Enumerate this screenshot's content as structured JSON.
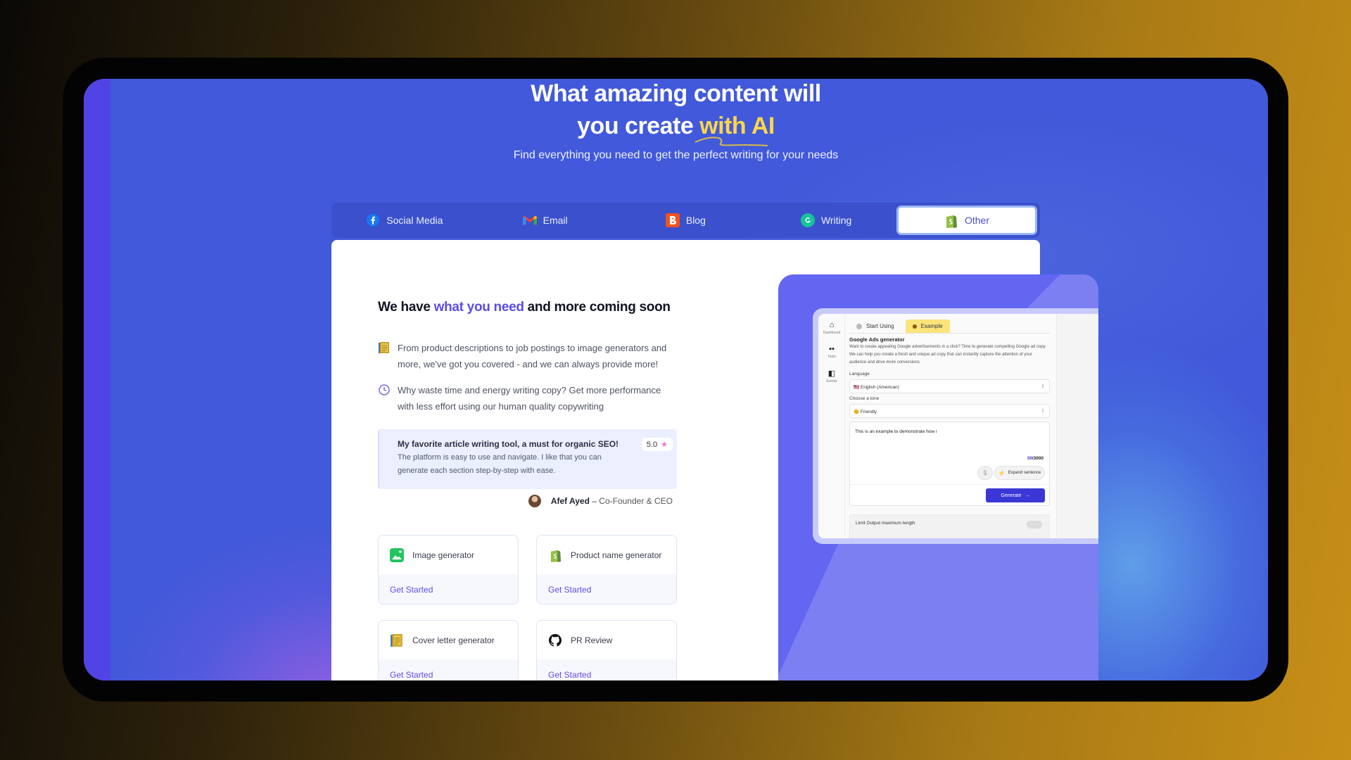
{
  "hero": {
    "title_line1": "What amazing content will",
    "title_line2_prefix": "you create ",
    "title_line2_highlight": "with AI",
    "subtitle": "Find everything you need to get the perfect writing for your needs"
  },
  "tabs": [
    {
      "label": "Social Media",
      "icon": "facebook-icon",
      "active": false
    },
    {
      "label": "Email",
      "icon": "gmail-icon",
      "active": false
    },
    {
      "label": "Blog",
      "icon": "blogger-icon",
      "active": false
    },
    {
      "label": "Writing",
      "icon": "grammarly-icon",
      "active": false
    },
    {
      "label": "Other",
      "icon": "shopify-icon",
      "active": true
    }
  ],
  "content": {
    "title_prefix": "We have ",
    "title_accent": "what you need",
    "title_suffix": " and more coming soon",
    "features": [
      {
        "icon": "notebook-icon",
        "text": "From product descriptions to job postings to image generators and more, we've got you covered - and we can always provide more!"
      },
      {
        "icon": "clock-icon",
        "text": "Why waste time and energy writing copy? Get more performance with less effort using our human quality copywriting"
      }
    ],
    "testimonial": {
      "title": "My favorite article writing tool, a must for organic SEO!",
      "body": "The platform is easy to use and navigate. I like that you can generate each section step-by-step with ease.",
      "rating": "5.0",
      "author_name": "Afef Ayed",
      "author_sep": " – ",
      "author_role": "Co-Founder & CEO"
    },
    "tools": [
      {
        "name": "Image generator",
        "icon": "image-icon",
        "cta": "Get Started"
      },
      {
        "name": "Product name generator",
        "icon": "shopify-icon",
        "cta": "Get Started"
      },
      {
        "name": "Cover letter generator",
        "icon": "notebook-icon",
        "cta": "Get Started"
      },
      {
        "name": "PR Review",
        "icon": "github-icon",
        "cta": "Get Started"
      }
    ]
  },
  "mock_app": {
    "sidebar": [
      {
        "icon": "home-icon",
        "label": "Dashboard"
      },
      {
        "icon": "tools-icon",
        "label": "Tools"
      },
      {
        "icon": "events-icon",
        "label": "Events"
      }
    ],
    "tabs": [
      "Start Using",
      "Example"
    ],
    "tool_title": "Google Ads generator",
    "tool_desc": "Want to create appealing Google advertisements in a click? Time to generate compelling Google ad copy. We can help you create a fresh and unique ad copy that can instantly capture the attention of your audience and drive more conversions.",
    "language_label": "Language",
    "language_value": "🇺🇸 English (American)",
    "tone_label": "Choose a tone",
    "tone_value": "😊 Friendly",
    "input_text": "This is an example to demonstrate how i",
    "count_current": "39",
    "count_max": "/3000",
    "expand_label": "Expand sentence",
    "generate_label": "Generate",
    "limit_label": "Limit Output maximum length"
  },
  "colors": {
    "accent": "#5b4de6",
    "highlight": "#fbd64a",
    "screen_bg": "#4159da",
    "promo_bg": "#6366f0",
    "generate_btn": "#3b36d6"
  }
}
